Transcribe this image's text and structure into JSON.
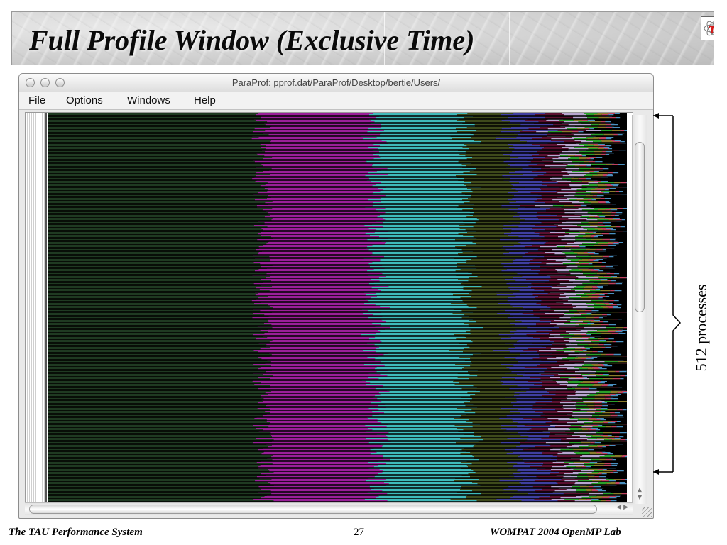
{
  "slide": {
    "title": "Full Profile Window (Exclusive Time)",
    "logo_glyph": "τ",
    "annotation": "512 processes",
    "footer_left": "The TAU Performance System",
    "page_number": "27",
    "footer_right": "WOMPAT 2004 OpenMP Lab"
  },
  "window": {
    "title": "ParaProf: pprof.dat/ParaProf/Desktop/bertie/Users/",
    "menu": [
      "File",
      "Options",
      "Windows",
      "Help"
    ]
  },
  "profile": {
    "process_count": 512,
    "segments": [
      {
        "color": "#1f3a22",
        "share": 0.38
      },
      {
        "color": "#9a1f99",
        "share": 0.2
      },
      {
        "color": "#3fb9b9",
        "share": 0.16
      },
      {
        "color": "#3e4a1b",
        "share": 0.08
      },
      {
        "color": "#3f3fa0",
        "share": 0.05
      },
      {
        "color": "#5a1030",
        "share": 0.04
      },
      {
        "color": "#b8a6d0",
        "share": 0.03
      },
      {
        "color": "#2aa02a",
        "share": 0.02
      },
      {
        "color": "#8a7a2a",
        "share": 0.015
      },
      {
        "color": "#c04060",
        "share": 0.01
      },
      {
        "color": "#4a90c0",
        "share": 0.01
      }
    ],
    "remainder_color": "#000000"
  }
}
